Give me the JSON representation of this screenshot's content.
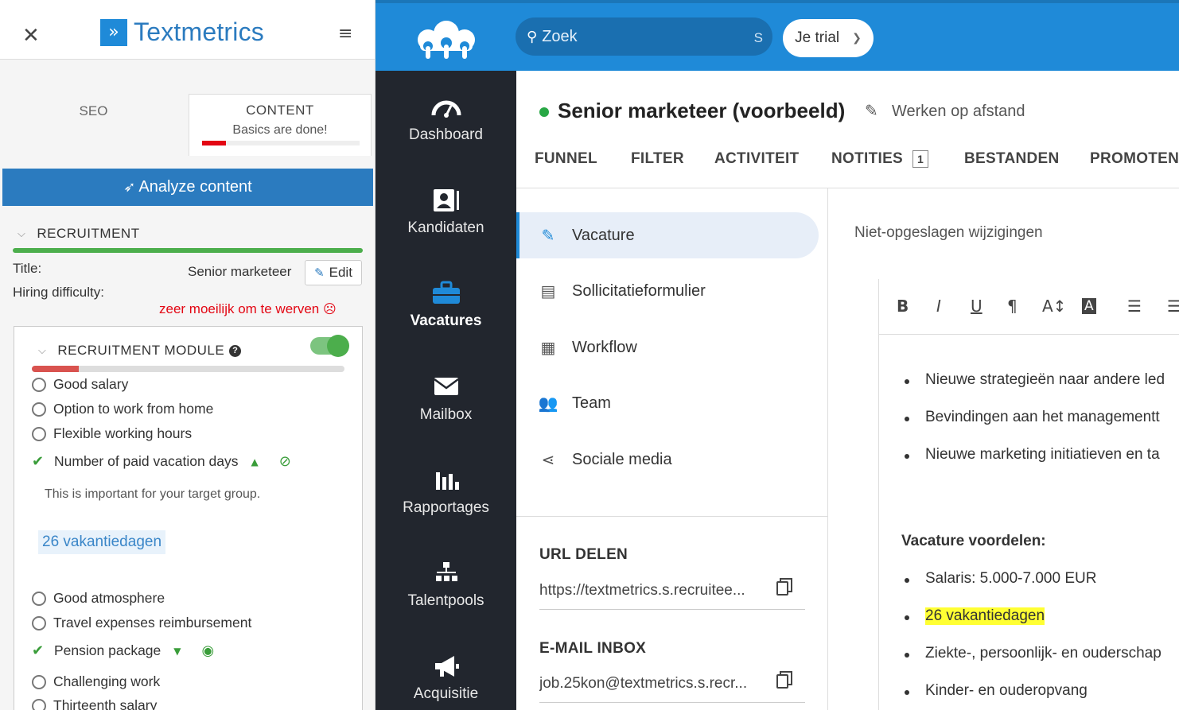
{
  "plugin": {
    "brand": "Textmetrics",
    "tabs": {
      "seo": "SEO",
      "content_title": "CONTENT",
      "content_sub": "Basics are done!",
      "content_progress": 0.15
    },
    "analyze_label": "Analyze content",
    "recruitment": {
      "heading": "RECRUITMENT",
      "title_label": "Title:",
      "title_value": "Senior marketeer",
      "edit_label": "Edit",
      "hiring_label": "Hiring difficulty:",
      "hiring_value": "zeer moeilijk om te werven"
    },
    "module": {
      "heading": "RECRUITMENT MODULE",
      "enabled": true,
      "progress": 0.15,
      "items": [
        {
          "label": "Good salary",
          "checked": false
        },
        {
          "label": "Option to work from home",
          "checked": false
        },
        {
          "label": "Flexible working hours",
          "checked": false
        },
        {
          "label": "Number of paid vacation days",
          "checked": true
        },
        {
          "label": "Good atmosphere",
          "checked": false
        },
        {
          "label": "Travel expenses reimbursement",
          "checked": false
        },
        {
          "label": "Pension package",
          "checked": true
        },
        {
          "label": "Challenging work",
          "checked": false
        },
        {
          "label": "Thirteenth salary",
          "checked": false
        }
      ],
      "important_note": "This is important for your target group.",
      "tag": "26 vakantiedagen"
    }
  },
  "topbar": {
    "search_placeholder": "Zoek",
    "search_shortcut": "S",
    "trial_label": "Je trial"
  },
  "sidenav": [
    {
      "label": "Dashboard",
      "icon": "speedometer-icon"
    },
    {
      "label": "Kandidaten",
      "icon": "contact-card-icon"
    },
    {
      "label": "Vacatures",
      "icon": "briefcase-icon",
      "active": true
    },
    {
      "label": "Mailbox",
      "icon": "envelope-icon"
    },
    {
      "label": "Rapportages",
      "icon": "bar-chart-icon"
    },
    {
      "label": "Talentpools",
      "icon": "org-chart-icon"
    },
    {
      "label": "Acquisitie",
      "icon": "megaphone-icon"
    }
  ],
  "job": {
    "title": "Senior marketeer (voorbeeld)",
    "location": "Werken op afstand",
    "tabs": [
      "FUNNEL",
      "FILTER",
      "ACTIVITEIT",
      "NOTITIES",
      "BESTANDEN",
      "PROMOTEN"
    ],
    "notes_count": "1",
    "subnav": [
      "Vacature",
      "Sollicitatieformulier",
      "Workflow",
      "Team",
      "Sociale media"
    ],
    "share": {
      "url_label": "URL DELEN",
      "url_value": "https://textmetrics.s.recruitee...",
      "email_label": "E-MAIL INBOX",
      "email_value": "job.25kon@textmetrics.s.recr..."
    },
    "unsaved": "Niet-opgeslagen wijzigingen"
  },
  "editor": {
    "bullets_top": [
      "Nieuwe strategieën naar andere led",
      "Bevindingen aan het managementt",
      "Nieuwe marketing initiatieven en ta"
    ],
    "heading": "Vacature voordelen:",
    "bullets_bottom": [
      "Salaris: 5.000-7.000 EUR",
      "26 vakantiedagen",
      "Ziekte-, persoonlijk- en ouderschap",
      "Kinder- en ouderopvang"
    ]
  }
}
